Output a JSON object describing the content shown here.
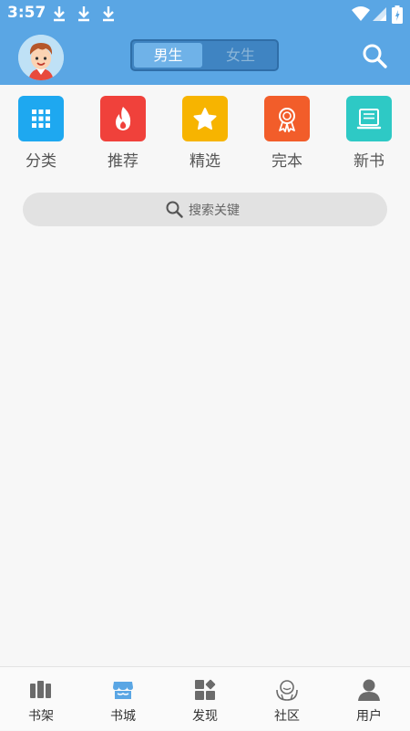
{
  "status_bar": {
    "time": "3:57",
    "icons": [
      "download-icon",
      "download-icon",
      "download-icon",
      "wifi-icon",
      "signal-icon",
      "battery-icon"
    ]
  },
  "header": {
    "avatar": "avatar",
    "gender_tabs": [
      {
        "label": "男生",
        "selected": true
      },
      {
        "label": "女生",
        "selected": false
      }
    ],
    "search_icon": "search-icon"
  },
  "categories": [
    {
      "label": "分类",
      "icon": "grid-icon",
      "color": "#1ea8f0"
    },
    {
      "label": "推荐",
      "icon": "fire-icon",
      "color": "#f0413b"
    },
    {
      "label": "精选",
      "icon": "star-icon",
      "color": "#f7b400"
    },
    {
      "label": "完本",
      "icon": "medal-icon",
      "color": "#f25d2a"
    },
    {
      "label": "新书",
      "icon": "book-icon",
      "color": "#2ec9c5"
    }
  ],
  "search": {
    "placeholder": "搜索关键"
  },
  "bottom_nav": [
    {
      "label": "书架",
      "icon": "bookshelf-icon",
      "active": false
    },
    {
      "label": "书城",
      "icon": "store-icon",
      "active": true
    },
    {
      "label": "发现",
      "icon": "discover-icon",
      "active": false
    },
    {
      "label": "社区",
      "icon": "community-icon",
      "active": false
    },
    {
      "label": "用户",
      "icon": "user-icon",
      "active": false
    }
  ],
  "colors": {
    "primary": "#5aa6e4",
    "active_nav": "#5aa6e4",
    "inactive_nav": "#6b6b6b"
  }
}
